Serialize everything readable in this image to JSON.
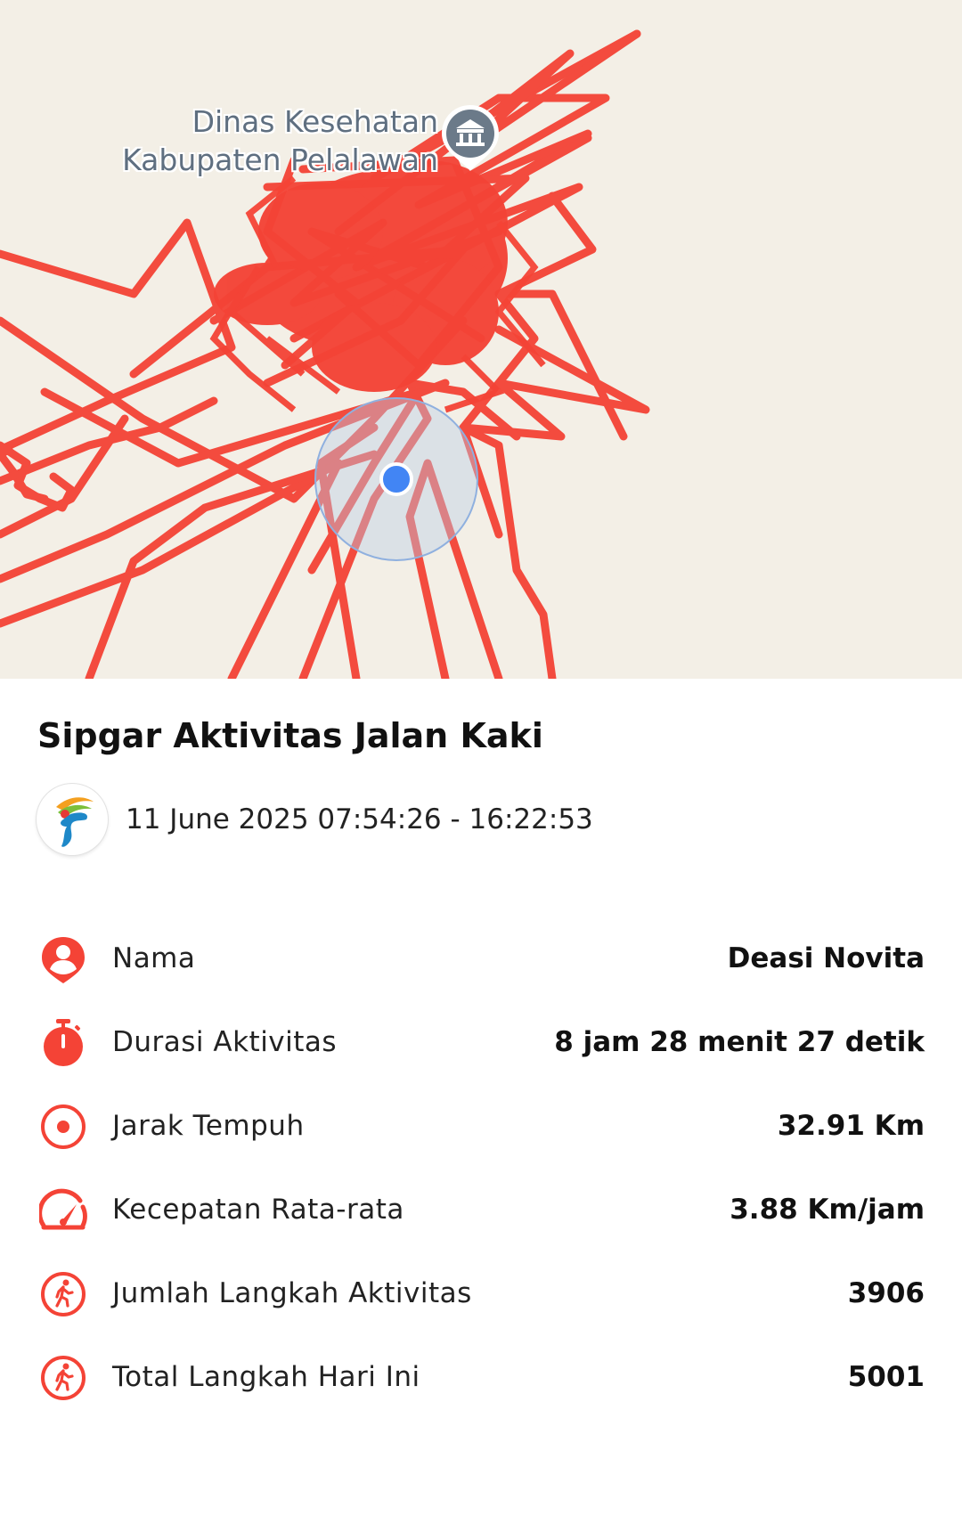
{
  "map": {
    "poi_label_line1": "Dinas Kesehatan",
    "poi_label_line2": "Kabupaten Pelalawan",
    "poi_icon": "government-building-icon",
    "route_color": "#f44336",
    "location_dot_color": "#4285f4",
    "background_color": "#f3efe6"
  },
  "activity": {
    "title": "Sipgar Aktivitas Jalan Kaki",
    "logo_icon": "sipgar-logo-icon",
    "datetime": "11 June 2025 07:54:26 - 16:22:53",
    "accent_color": "#f44336",
    "stats": [
      {
        "icon": "person-pin-icon",
        "label": "Nama",
        "value": "Deasi Novita"
      },
      {
        "icon": "stopwatch-icon",
        "label": "Durasi Aktivitas",
        "value": "8 jam 28 menit 27 detik"
      },
      {
        "icon": "target-icon",
        "label": "Jarak Tempuh",
        "value": "32.91 Km"
      },
      {
        "icon": "speedometer-icon",
        "label": "Kecepatan Rata-rata",
        "value": "3.88 Km/jam"
      },
      {
        "icon": "walking-icon",
        "label": "Jumlah Langkah Aktivitas",
        "value": "3906"
      },
      {
        "icon": "walking-icon",
        "label": "Total Langkah Hari Ini",
        "value": "5001"
      }
    ]
  }
}
